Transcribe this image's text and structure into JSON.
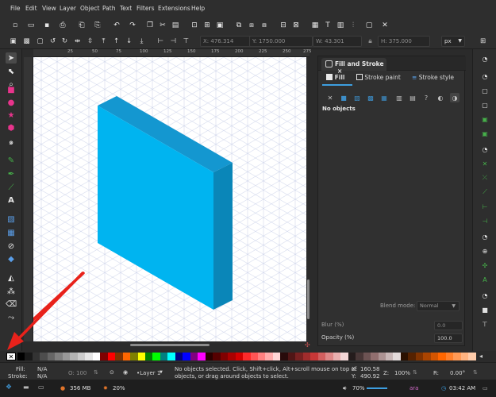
{
  "menu": [
    "File",
    "Edit",
    "View",
    "Layer",
    "Object",
    "Path",
    "Text",
    "Filters",
    "Extensions",
    "Help"
  ],
  "controls": {
    "x_label": "X:",
    "x_value": "476.314",
    "y_label": "Y:",
    "y_value": "1750.000",
    "w_label": "W:",
    "w_value": "43.301",
    "h_label": "H:",
    "h_value": "375.000",
    "unit": "px"
  },
  "ruler_ticks": [
    "25",
    "50",
    "75",
    "100",
    "125",
    "150",
    "175",
    "200",
    "225",
    "250",
    "275"
  ],
  "dialog": {
    "title": "Fill and Stroke",
    "close": "×",
    "tabs": [
      "Fill",
      "Stroke paint",
      "Stroke style"
    ],
    "message": "No objects",
    "blend_label": "Blend mode:",
    "blend_value": "Normal",
    "blur_label": "Blur (%)",
    "blur_value": "0.0",
    "opacity_label": "Opacity (%)",
    "opacity_value": "100.0"
  },
  "status": {
    "fill_label": "Fill:",
    "fill_value": "N/A",
    "stroke_label": "Stroke:",
    "stroke_value": "N/A",
    "opacity_label": "O:",
    "opacity_value": "100",
    "layer": "•Layer 1",
    "message_line1": "No objects selected. Click, Shift+click, Alt+scroll mouse on top of",
    "message_line2": "objects, or drag around objects to select.",
    "x_label": "X:",
    "x_value": "160.58",
    "y_label": "Y:",
    "y_value": "490.92",
    "z_label": "Z:",
    "zoom": "100%",
    "r_label": "R:",
    "rotation": "0.00°"
  },
  "taskbar": {
    "memory": "356 MB",
    "cpu": "20%",
    "volume": "70%",
    "keyboard": "ara",
    "clock": "03:42 AM"
  },
  "colors": {
    "accent": "#3d9ee0",
    "box_front": "#00b4f0",
    "box_top": "#1497d0",
    "box_side": "#0a86b8",
    "arrow": "#e8221b"
  },
  "palette": [
    "#000000",
    "#1a1a1a",
    "#333333",
    "#4d4d4d",
    "#666666",
    "#808080",
    "#999999",
    "#b3b3b3",
    "#cccccc",
    "#e6e6e6",
    "#ffffff",
    "#800000",
    "#ff0000",
    "#803300",
    "#ff6600",
    "#808000",
    "#ffff00",
    "#008000",
    "#00ff00",
    "#008080",
    "#00ffff",
    "#000080",
    "#0000ff",
    "#800080",
    "#ff00ff",
    "#2b0000",
    "#550000",
    "#800000",
    "#aa0000",
    "#d40000",
    "#ff2a2a",
    "#ff5555",
    "#ff8080",
    "#ffaaaa",
    "#ffd5d5",
    "#280b0b",
    "#501616",
    "#782121",
    "#a02c2c",
    "#c83737",
    "#d35f5f",
    "#de8787",
    "#e9afaf",
    "#f4d7d7",
    "#241c1c",
    "#483737",
    "#6c5353",
    "#916f6f",
    "#ac9393",
    "#c8b7b7",
    "#e3dbdb",
    "#2b1100",
    "#552200",
    "#803300",
    "#aa4400",
    "#d45500",
    "#ff6600",
    "#ff7f2a",
    "#ff9955",
    "#ffb380",
    "#ffccaa"
  ]
}
